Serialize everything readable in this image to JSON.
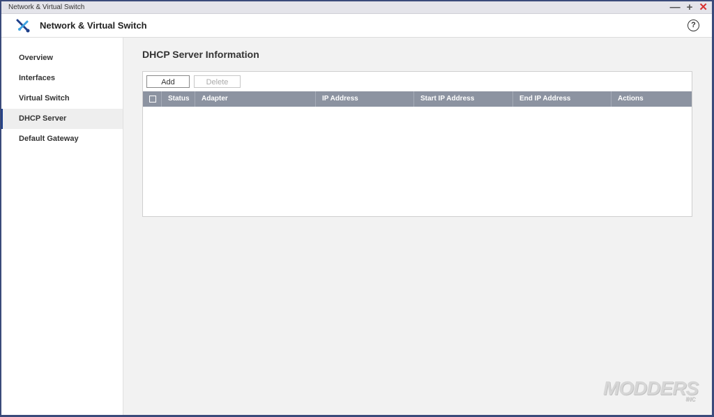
{
  "window": {
    "title": "Network & Virtual Switch"
  },
  "header": {
    "app_title": "Network & Virtual Switch",
    "help_icon": "?"
  },
  "sidebar": {
    "items": [
      {
        "label": "Overview",
        "active": false
      },
      {
        "label": "Interfaces",
        "active": false
      },
      {
        "label": "Virtual Switch",
        "active": false
      },
      {
        "label": "DHCP Server",
        "active": true
      },
      {
        "label": "Default Gateway",
        "active": false
      }
    ]
  },
  "main": {
    "title": "DHCP Server Information",
    "toolbar": {
      "add_label": "Add",
      "delete_label": "Delete"
    },
    "table": {
      "columns": [
        "Status",
        "Adapter",
        "IP Address",
        "Start IP Address",
        "End IP Address",
        "Actions"
      ],
      "rows": []
    }
  },
  "watermark": {
    "text": "MODDERS",
    "sub": "INC"
  },
  "colors": {
    "accent": "#1e3f8a",
    "table_header": "#8c93a1",
    "close": "#d93030"
  }
}
